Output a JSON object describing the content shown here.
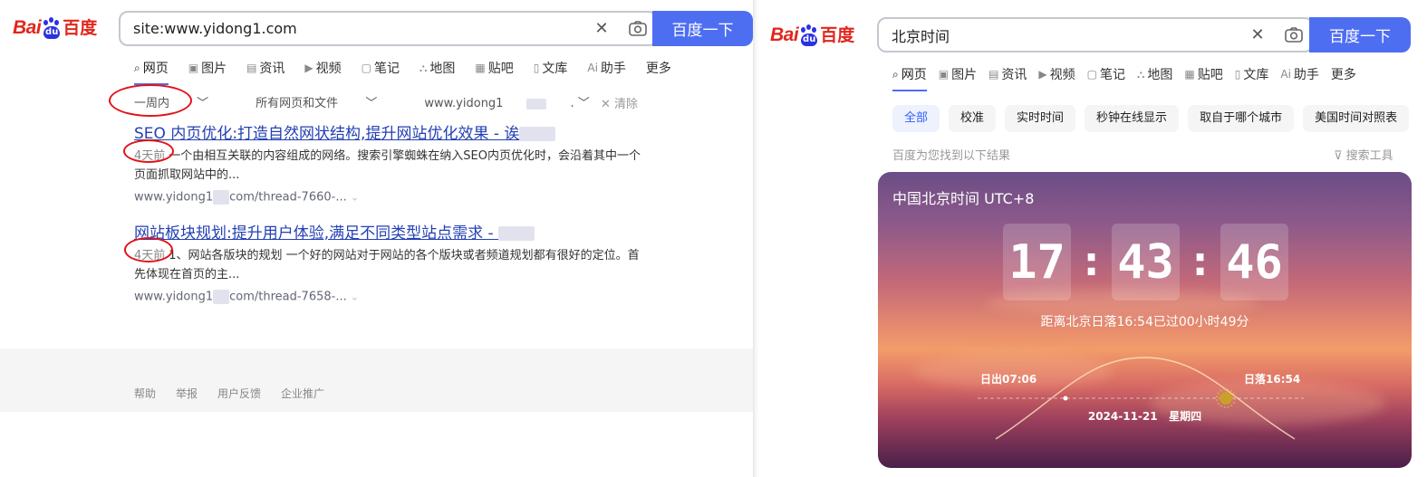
{
  "left": {
    "logo": {
      "bai": "Bai",
      "du": "du",
      "baidu_cn": "百度"
    },
    "search": {
      "value": "site:www.yidong1.com",
      "button": "百度一下"
    },
    "tabs": [
      {
        "label": "网页",
        "icon": "search-icon"
      },
      {
        "label": "图片",
        "icon": "image-icon"
      },
      {
        "label": "资讯",
        "icon": "news-icon"
      },
      {
        "label": "视频",
        "icon": "video-icon"
      },
      {
        "label": "笔记",
        "icon": "note-icon"
      },
      {
        "label": "地图",
        "icon": "map-icon"
      },
      {
        "label": "贴吧",
        "icon": "tieba-icon"
      },
      {
        "label": "文库",
        "icon": "doc-icon"
      },
      {
        "label": "助手",
        "icon": "ai-icon"
      },
      {
        "label": "更多",
        "icon": ""
      }
    ],
    "filters": {
      "time": "一周内",
      "type": "所有网页和文件",
      "site": "www.yidong1",
      "clear": "清除"
    },
    "results": [
      {
        "title": "SEO 内页优化:打造自然网状结构,提升网站优化效果 - 诶",
        "date": "4天前",
        "desc": "一个由相互关联的内容组成的网络。搜索引擎蜘蛛在纳入SEO内页优化时，会沿着其中一个页面抓取网站中的...",
        "url_prefix": "www.yidong1",
        "url_suffix": "com/thread-7660-..."
      },
      {
        "title": "网站板块规划:提升用户体验,满足不同类型站点需求 - ",
        "date": "4天前",
        "desc": "1、网站各版块的规划 一个好的网站对于网站的各个版块或者频道规划都有很好的定位。首先体现在首页的主...",
        "url_prefix": "www.yidong1",
        "url_suffix": "com/thread-7658-..."
      }
    ],
    "footer": [
      "帮助",
      "举报",
      "用户反馈",
      "企业推广"
    ]
  },
  "right": {
    "logo": {
      "bai": "Bai",
      "du": "du",
      "baidu_cn": "百度"
    },
    "search": {
      "value": "北京时间",
      "button": "百度一下"
    },
    "tabs": [
      {
        "label": "网页",
        "icon": "search-icon"
      },
      {
        "label": "图片",
        "icon": "image-icon"
      },
      {
        "label": "资讯",
        "icon": "news-icon"
      },
      {
        "label": "视频",
        "icon": "video-icon"
      },
      {
        "label": "笔记",
        "icon": "note-icon"
      },
      {
        "label": "地图",
        "icon": "map-icon"
      },
      {
        "label": "贴吧",
        "icon": "tieba-icon"
      },
      {
        "label": "文库",
        "icon": "doc-icon"
      },
      {
        "label": "助手",
        "icon": "ai-icon"
      },
      {
        "label": "更多",
        "icon": ""
      }
    ],
    "chips": [
      "全部",
      "校准",
      "实时时间",
      "秒钟在线显示",
      "取自于哪个城市",
      "美国时间对照表"
    ],
    "found_text": "百度为您找到以下结果",
    "tools_text": "搜索工具",
    "card": {
      "title": "中国北京时间 UTC+8",
      "hours": "17",
      "minutes": "43",
      "seconds": "46",
      "sunset_info": "距离北京日落16:54已过00小时49分",
      "sunrise": "日出07:06",
      "sunset": "日落16:54",
      "date": "2024-11-21   星期四"
    }
  },
  "colors": {
    "accent": "#4e6ef2",
    "link": "#2440b3",
    "brand_red": "#e1261c",
    "brand_blue": "#2932e1",
    "annotation_red": "#e0131a"
  }
}
